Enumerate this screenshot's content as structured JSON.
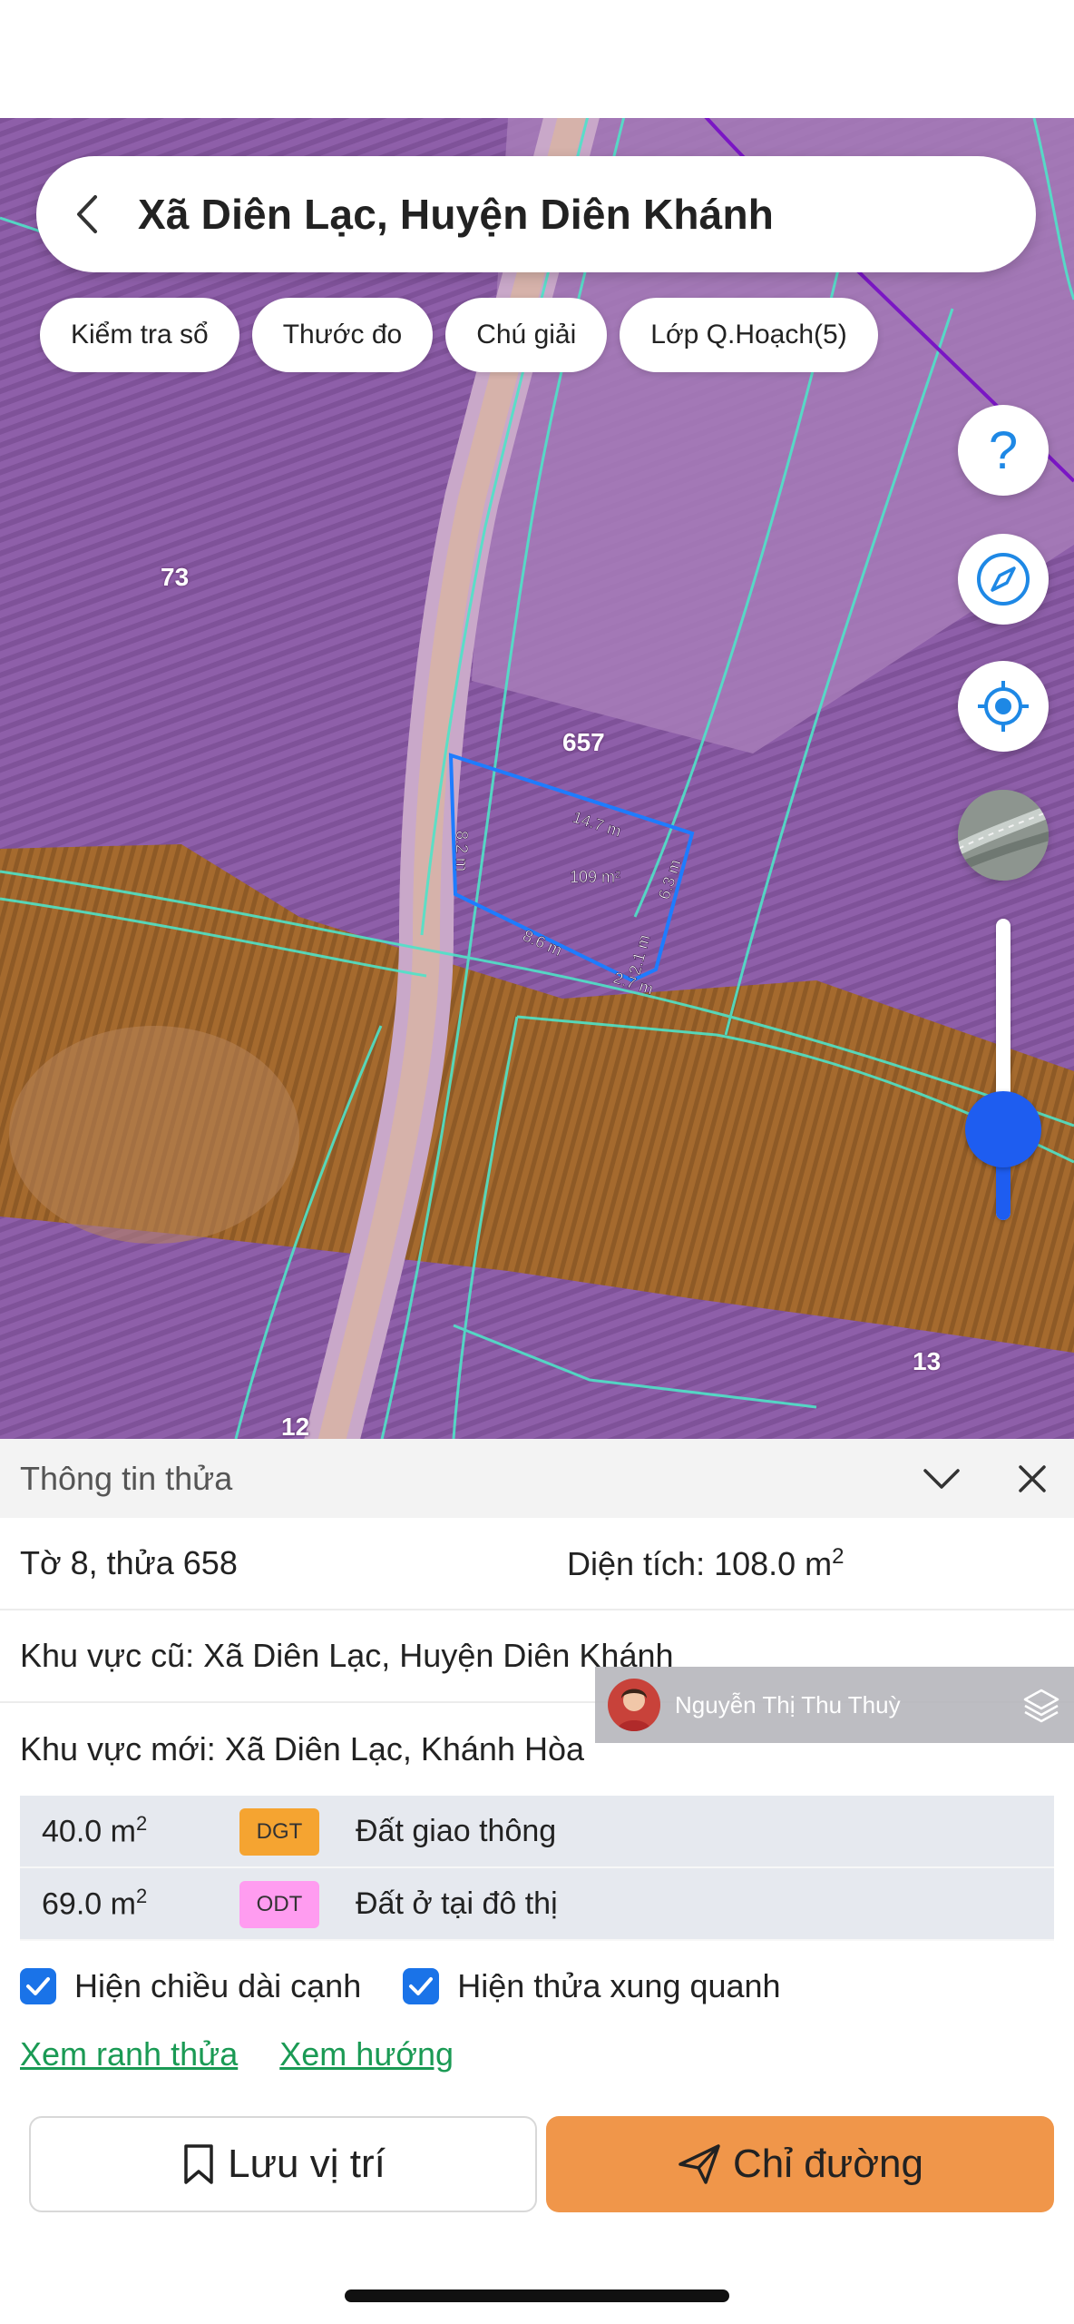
{
  "search": {
    "title": "Xã Diên Lạc, Huyện Diên Khánh"
  },
  "chips": [
    "Kiểm tra sổ",
    "Thước đo",
    "Chú giải",
    "Lớp Q.Hoạch(5)"
  ],
  "map": {
    "labels": {
      "parcel_73": "73",
      "parcel_657": "657",
      "parcel_13": "13",
      "parcel_12": "12"
    },
    "parcel": {
      "area": "109 m²",
      "edges": [
        "14.7 m",
        "8.2 m",
        "6.3 m",
        "8.6 m",
        "2.1 m",
        "2.7 m"
      ]
    },
    "zoom_level_fraction": 0.3,
    "icons": [
      "back-icon",
      "help-icon",
      "compass-icon",
      "locate-icon",
      "satellite-layer-icon"
    ]
  },
  "panel": {
    "title": "Thông tin thửa",
    "sheet_parcel": "Tờ 8, thửa 658",
    "area_label": "Diện tích: 108.0 m",
    "area_sup": "2",
    "old_region": "Khu vực cũ: Xã Diên Lạc, Huyện Diên Khánh",
    "new_region": "Khu vực mới: Xã Diên Lạc, Khánh Hòa",
    "land_uses": [
      {
        "area": "40.0 m",
        "sup": "2",
        "code": "DGT",
        "color": "#f5a431",
        "desc": "Đất giao thông"
      },
      {
        "area": "69.0 m",
        "sup": "2",
        "code": "ODT",
        "color": "#ff9cf0",
        "desc": "Đất ở tại đô thị"
      }
    ],
    "checkboxes": [
      {
        "label": "Hiện chiều dài cạnh",
        "checked": true
      },
      {
        "label": "Hiện thửa xung quanh",
        "checked": true
      }
    ],
    "links": [
      "Xem ranh thửa",
      "Xem hướng"
    ],
    "save_label": "Lưu vị trí",
    "route_label": "Chỉ đường"
  },
  "overlay": {
    "name": "Nguyễn Thị Thu Thuỳ"
  },
  "colors": {
    "accent": "#1a73e8",
    "route": "#f0964a",
    "zoom": "#1e5df0",
    "link": "#1a9a54"
  }
}
